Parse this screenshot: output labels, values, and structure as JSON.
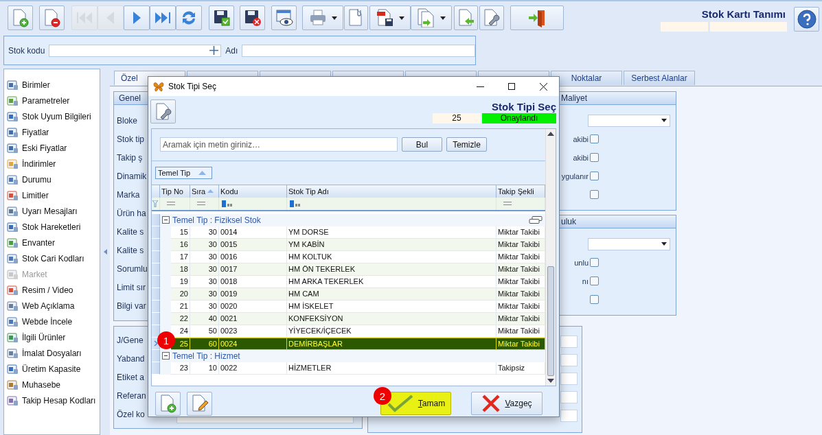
{
  "toolbar": [
    {
      "disabled": false,
      "has_menu": false
    },
    {
      "disabled": false,
      "has_menu": false
    },
    {
      "disabled": true,
      "has_menu": false
    },
    {
      "disabled": true,
      "has_menu": false
    },
    {
      "disabled": false,
      "has_menu": false
    },
    {
      "disabled": false,
      "has_menu": false
    },
    {
      "disabled": false,
      "has_menu": false
    },
    {
      "disabled": false,
      "has_menu": false
    },
    {
      "disabled": false,
      "has_menu": false
    },
    {
      "disabled": false,
      "has_menu": false
    },
    {
      "disabled": false,
      "has_menu": true
    },
    {
      "disabled": false,
      "has_menu": false
    },
    {
      "disabled": false,
      "has_menu": true
    },
    {
      "disabled": false,
      "has_menu": true
    },
    {
      "disabled": false,
      "has_menu": false
    },
    {
      "disabled": false,
      "has_menu": false
    },
    {
      "disabled": false,
      "has_menu": false
    }
  ],
  "header": {
    "title": "Stok Kartı Tanımı"
  },
  "search": {
    "code_label": "Stok kodu",
    "name_label": "Adı"
  },
  "sidebar": {
    "items": [
      {
        "label": "Birimler",
        "disabled": false
      },
      {
        "label": "Parametreler",
        "disabled": false
      },
      {
        "label": "Stok Uyum Bilgileri",
        "disabled": false
      },
      {
        "label": "Fiyatlar",
        "disabled": false
      },
      {
        "label": "Eski Fiyatlar",
        "disabled": false
      },
      {
        "label": "İndirimler",
        "disabled": false
      },
      {
        "label": "Durumu",
        "disabled": false
      },
      {
        "label": "Limitler",
        "disabled": false
      },
      {
        "label": "Uyarı Mesajları",
        "disabled": false
      },
      {
        "label": "Stok Hareketleri",
        "disabled": false
      },
      {
        "label": "Envanter",
        "disabled": false
      },
      {
        "label": "Stok Cari Kodları",
        "disabled": false
      },
      {
        "label": "Market",
        "disabled": true
      },
      {
        "label": "Resim / Video",
        "disabled": false
      },
      {
        "label": "Web Açıklama",
        "disabled": false
      },
      {
        "label": "Webde İncele",
        "disabled": false
      },
      {
        "label": "İlgili Ürünler",
        "disabled": false
      },
      {
        "label": "İmalat Dosyaları",
        "disabled": false
      },
      {
        "label": "Üretim Kapasite",
        "disabled": false
      },
      {
        "label": "Muhasebe",
        "disabled": false
      },
      {
        "label": "Takip Hesap Kodları",
        "disabled": false
      }
    ]
  },
  "tabs": [
    {
      "label": "Özel",
      "selected": true
    },
    {
      "selected": false
    },
    {
      "selected": false
    },
    {
      "selected": false
    },
    {
      "selected": false
    },
    {
      "selected": false
    },
    {
      "label": "Noktalar",
      "selected": false
    },
    {
      "label": "Serbest Alanlar",
      "selected": false
    }
  ],
  "left_groups": [
    {
      "title": "Genel",
      "rows": [
        {
          "label": "Bloke"
        },
        {
          "label": "Stok tip"
        },
        {
          "label": "Takip ş"
        },
        {
          "label": "Dinamik"
        },
        {
          "label": "Marka"
        },
        {
          "label": "Ürün ha"
        },
        {
          "label": "Kalite s"
        },
        {
          "label": "Kalite s"
        },
        {
          "label": "Sorumlu"
        },
        {
          "label": "Limit sır"
        },
        {
          "label": "Bilgi var"
        }
      ]
    },
    {
      "rows": [
        {
          "label": "J/Gene"
        },
        {
          "label": "Yaband"
        },
        {
          "label": "Etiket a"
        },
        {
          "label": "Referan"
        },
        {
          "label": "Özel ko",
          "has_field": true
        }
      ]
    }
  ],
  "right_groups": [
    {
      "title": "Maliyet",
      "rows": [
        {
          "kind": "select"
        },
        {
          "kind": "check",
          "label": "akibi",
          "checked": false
        },
        {
          "kind": "check",
          "label": "akibi",
          "checked": false
        },
        {
          "kind": "check",
          "label": "ygulanır",
          "checked": false
        },
        {
          "kind": "check",
          "checked": false
        }
      ]
    },
    {
      "title": "uluk",
      "rows": [
        {
          "kind": "select"
        },
        {
          "kind": "check",
          "label": "unlu",
          "checked": false
        },
        {
          "kind": "check",
          "label": "nı",
          "checked": false
        },
        {
          "kind": "check",
          "checked": false
        }
      ]
    },
    {
      "rows": [
        {
          "kind": "field"
        },
        {
          "kind": "field"
        },
        {
          "kind": "field"
        },
        {
          "kind": "field"
        },
        {
          "kind": "field"
        }
      ]
    }
  ],
  "dialog": {
    "title": "Stok Tipi Seç",
    "heading": "Stok Tipi Seç",
    "record_no": "25",
    "status": "Onaylandı",
    "search": {
      "placeholder": "Aramak için metin giriniz…"
    },
    "find_button": "Bul",
    "clear_button": "Temizle",
    "group_by": "Temel Tip",
    "columns": [
      {
        "label": "Tip No",
        "sorted": false
      },
      {
        "label": "Sıra",
        "sorted": true
      },
      {
        "label": "Kodu",
        "sorted": false
      },
      {
        "label": "Stok Tip Adı",
        "sorted": false
      },
      {
        "label": "Takip Şekli",
        "sorted": false
      }
    ],
    "groups": [
      {
        "label": "Temel Tip : Fiziksel Stok",
        "expanded": true,
        "rows": [
          {
            "cells": [
              "15",
              "30",
              "0014",
              "YM DORSE",
              "Miktar Takibi"
            ],
            "selected": false
          },
          {
            "cells": [
              "16",
              "30",
              "0015",
              "YM KABİN",
              "Miktar Takibi"
            ],
            "selected": false
          },
          {
            "cells": [
              "17",
              "30",
              "0016",
              "HM KOLTUK",
              "Miktar Takibi"
            ],
            "selected": false
          },
          {
            "cells": [
              "18",
              "30",
              "0017",
              "HM ÖN TEKERLEK",
              "Miktar Takibi"
            ],
            "selected": false
          },
          {
            "cells": [
              "19",
              "30",
              "0018",
              "HM ARKA TEKERLEK",
              "Miktar Takibi"
            ],
            "selected": false
          },
          {
            "cells": [
              "20",
              "30",
              "0019",
              "HM CAM",
              "Miktar Takibi"
            ],
            "selected": false
          },
          {
            "cells": [
              "21",
              "30",
              "0020",
              "HM İSKELET",
              "Miktar Takibi"
            ],
            "selected": false
          },
          {
            "cells": [
              "22",
              "40",
              "0021",
              "KONFEKSİYON",
              "Miktar Takibi"
            ],
            "selected": false
          },
          {
            "cells": [
              "24",
              "50",
              "0023",
              "YİYECEK/İÇECEK",
              "Miktar Takibi"
            ],
            "selected": false
          },
          {
            "cells": [
              "25",
              "60",
              "0024",
              "DEMİRBAŞLAR",
              "Miktar Takibi"
            ],
            "selected": true
          }
        ]
      },
      {
        "label": "Temel Tip : Hizmet",
        "expanded": true,
        "rows": [
          {
            "cells": [
              "23",
              "10",
              "0022",
              "HİZMETLER",
              "Takipsiz"
            ],
            "selected": false
          }
        ]
      }
    ],
    "ok_button": {
      "label": "Tamam",
      "highlighted": true
    },
    "cancel_button": "Vazgeç"
  },
  "callouts": [
    {
      "label": "1"
    },
    {
      "label": "2"
    }
  ]
}
